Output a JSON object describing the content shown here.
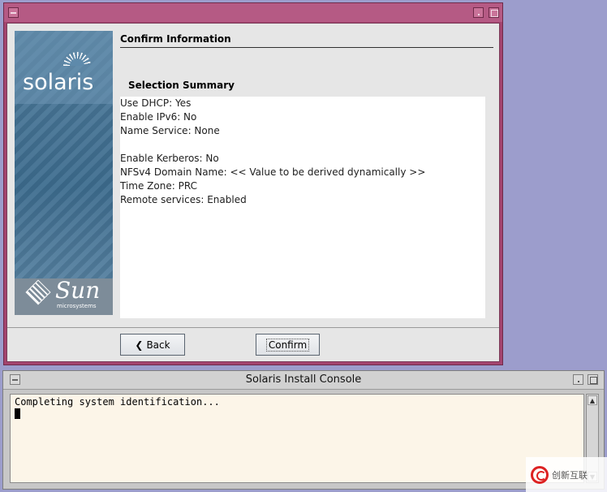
{
  "installer": {
    "page_title": "Confirm Information",
    "section_title": "Selection Summary",
    "branding": {
      "product": "solaris",
      "vendor": "Sun",
      "vendor_sub": "microsystems"
    },
    "summary_lines": [
      "Use DHCP: Yes",
      "Enable IPv6: No",
      "Name Service: None",
      "",
      "Enable Kerberos: No",
      "NFSv4 Domain Name: << Value to be derived dynamically >>",
      "Time Zone: PRC",
      "Remote services: Enabled"
    ],
    "buttons": {
      "back": "Back",
      "confirm": "Confirm"
    },
    "icons": {
      "back": "back-arrow-icon"
    },
    "colors": {
      "window_frame": "#a4446f",
      "client_bg": "#e6e6e6"
    }
  },
  "console": {
    "title": "Solaris Install Console",
    "output": "Completing system identification..."
  },
  "watermark": {
    "text": "创新互联"
  },
  "desktop": {
    "background": "#9c9dcc"
  }
}
